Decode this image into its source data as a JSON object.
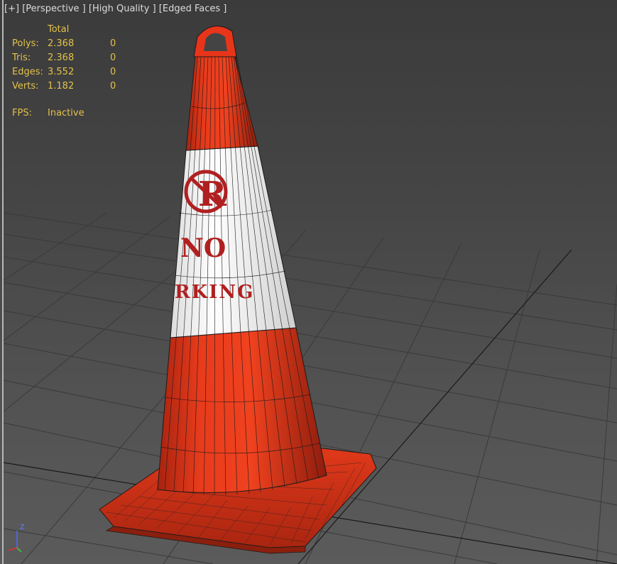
{
  "viewport": {
    "labels": [
      "[+]",
      "[Perspective ]",
      "[High Quality ]",
      "[Edged Faces ]"
    ]
  },
  "stats": {
    "header": "Total",
    "rows": [
      {
        "label": "Polys:",
        "total": "2.368",
        "selected": "0"
      },
      {
        "label": "Tris:",
        "total": "2.368",
        "selected": "0"
      },
      {
        "label": "Edges:",
        "total": "3.552",
        "selected": "0"
      },
      {
        "label": "Verts:",
        "total": "1.182",
        "selected": "0"
      }
    ],
    "fps_label": "FPS:",
    "fps_value": "Inactive"
  },
  "cone": {
    "text_top": "NO",
    "text_bottom": "RKING",
    "color_orange": "#e8351a",
    "color_white": "#ffffff",
    "color_print": "#b02020"
  },
  "gizmo": {
    "axis_label": "Z"
  }
}
